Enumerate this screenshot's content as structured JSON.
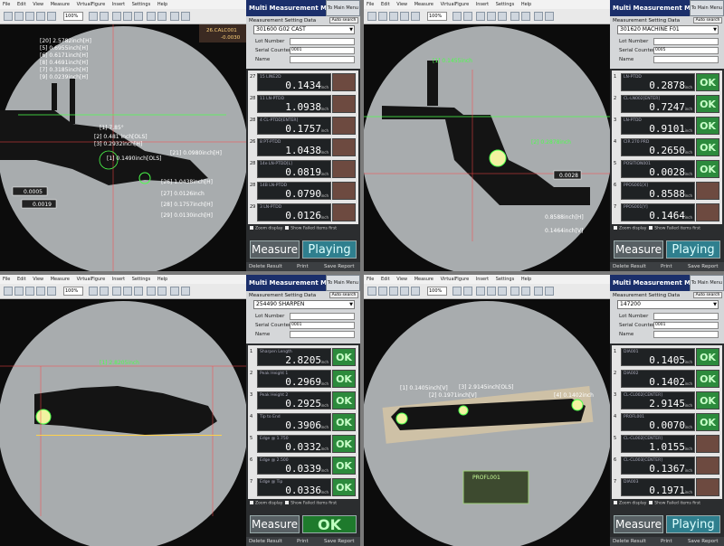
{
  "menu": [
    "File",
    "Edit",
    "View",
    "Measure",
    "VirtualFigure",
    "Insert",
    "Settings",
    "Help"
  ],
  "zoom": "100%",
  "panel_common": {
    "mode_title": "Multi Measurement Mode",
    "main_menu": "To Main Menu",
    "setting_label": "Measurement Setting Data",
    "auto_search": "Auto search",
    "lot_label": "Lot Number",
    "serial_label": "Serial Counter",
    "name_label": "Name",
    "serial_value": "0001",
    "zoom_display": "Zoom display",
    "show_failed": "Show Failed items first",
    "measure": "Measure",
    "delete_result": "Delete Result",
    "print": "Print",
    "save_report": "Save Report",
    "unit": "inch"
  },
  "panels": [
    {
      "program": "301600 G02 CAST",
      "serial": "0001",
      "state": "Playing",
      "rows": [
        {
          "num": "27",
          "name": "15 LINE2D",
          "val": "0.1434",
          "judge": ""
        },
        {
          "num": "28",
          "name": "11 LN-PTDD",
          "val": "1.0938",
          "judge": ""
        },
        {
          "num": "28",
          "name": "4 CL-PTDD[ENTER]",
          "val": "0.1757",
          "judge": ""
        },
        {
          "num": "26",
          "name": "8 PT-PTDD",
          "val": "1.0438",
          "judge": ""
        },
        {
          "num": "28",
          "name": "14e LN-PTDD[L]",
          "val": "0.0819",
          "judge": ""
        },
        {
          "num": "28",
          "name": "14B LN-PTDD",
          "val": "0.0790",
          "judge": ""
        },
        {
          "num": "29",
          "name": "3 LN-PTDD",
          "val": "0.0126",
          "judge": ""
        }
      ],
      "top_value": "0.1496"
    },
    {
      "program": "301620 MACHINE F01",
      "serial": "0005",
      "state": "Playing",
      "rows": [
        {
          "num": "1",
          "name": "LN-PTDD",
          "val": "0.2878",
          "judge": "OK"
        },
        {
          "num": "2",
          "name": "CL-LN002[ENTER]",
          "val": "0.7247",
          "judge": "OK"
        },
        {
          "num": "3",
          "name": "LN-PTDD",
          "val": "0.9101",
          "judge": "OK"
        },
        {
          "num": "4",
          "name": "CIR 270 PRD",
          "val": "0.2650",
          "judge": "OK"
        },
        {
          "num": "5",
          "name": "POSITION001",
          "val": "0.0028",
          "judge": "OK"
        },
        {
          "num": "6",
          "name": "PPOS001[X]",
          "val": "0.8588",
          "judge": ""
        },
        {
          "num": "7",
          "name": "PPOS001[Y]",
          "val": "0.1464",
          "judge": ""
        }
      ]
    },
    {
      "program": "254490 SHARPEN",
      "serial": "0001",
      "state": "OK",
      "rows": [
        {
          "num": "1",
          "name": "Sharpen Length",
          "val": "2.8205",
          "judge": "OK"
        },
        {
          "num": "2",
          "name": "Peak Height 1",
          "val": "0.2969",
          "judge": "OK"
        },
        {
          "num": "3",
          "name": "Peak Height 2",
          "val": "0.2925",
          "judge": "OK"
        },
        {
          "num": "4",
          "name": "Tip to End",
          "val": "0.3906",
          "judge": "OK"
        },
        {
          "num": "5",
          "name": "Edge @ 1.750",
          "val": "0.0332",
          "judge": "OK"
        },
        {
          "num": "6",
          "name": "Edge @ 2.500",
          "val": "0.0339",
          "judge": "OK"
        },
        {
          "num": "7",
          "name": "Edge @ Tip",
          "val": "0.0336",
          "judge": "OK"
        }
      ]
    },
    {
      "program": "147200",
      "serial": "0001",
      "state": "Playing",
      "rows": [
        {
          "num": "1",
          "name": "DIA001",
          "val": "0.1405",
          "judge": "OK"
        },
        {
          "num": "2",
          "name": "DIA002",
          "val": "0.1402",
          "judge": "OK"
        },
        {
          "num": "3",
          "name": "CL-CL002[CENTER]",
          "val": "2.9145",
          "judge": "OK"
        },
        {
          "num": "4",
          "name": "PROFL001",
          "val": "0.0070",
          "judge": "OK"
        },
        {
          "num": "5",
          "name": "CL-CL002[CENTER]",
          "val": "1.0155",
          "judge": ""
        },
        {
          "num": "6",
          "name": "CL-CL003[CENTER]",
          "val": "0.1367",
          "judge": ""
        },
        {
          "num": "7",
          "name": "DIA003",
          "val": "0.1971",
          "judge": ""
        }
      ]
    }
  ],
  "view_labels": {
    "q0": [
      "[20] 2.5782inch[H]",
      "[5] 0.6955inch[H]",
      "[6] 0.6171inch[H]",
      "[8] 0.4691inch[H]",
      "[7] 0.3185inch[H]",
      "[9] 0.0239inch[H]",
      "[1] 7.85°",
      "[2] 0.481 inch[OLS]",
      "[3] 0.2932inch[H]",
      "[1] 0.1490inch[OLS]",
      "[26] 1.0438inch[H]",
      "[27] 0.0126inch",
      "[28] 0.1757inch[H]",
      "[29] 0.0130inch[H]",
      "[21] 0.0980inch[H]",
      "0.0005",
      "0.0019",
      "26.CALC001",
      "-0.0030"
    ],
    "q1": [
      "[1] 0.1455inch",
      "[2] 0.2878inch",
      "0.0028",
      "0.8588inch[H]",
      "0.1464inch[V]"
    ],
    "q2": [
      "[1] 2.8205inch"
    ],
    "q3": [
      "[1] 0.1405inch[V]",
      "[3] 2.9145inch[OLS]",
      "[2] 0.1971inch[V]",
      "[4] 0.1402inch",
      "PROFL001"
    ]
  }
}
